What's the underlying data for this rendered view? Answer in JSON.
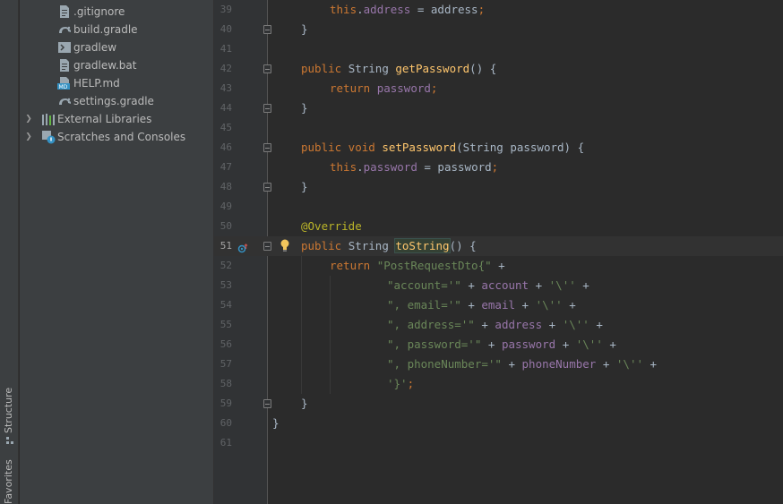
{
  "tool_tabs": {
    "structure": "Structure",
    "favorites": "Favorites"
  },
  "project_tree": [
    {
      "label": ".gitignore",
      "icon": "text-file-icon"
    },
    {
      "label": "build.gradle",
      "icon": "gradle-icon"
    },
    {
      "label": "gradlew",
      "icon": "shell-script-icon"
    },
    {
      "label": "gradlew.bat",
      "icon": "text-file-icon"
    },
    {
      "label": "HELP.md",
      "icon": "markdown-icon"
    },
    {
      "label": "settings.gradle",
      "icon": "gradle-icon"
    },
    {
      "label": "External Libraries",
      "icon": "libraries-icon",
      "expandable": true
    },
    {
      "label": "Scratches and Consoles",
      "icon": "scratches-icon",
      "expandable": true
    }
  ],
  "editor": {
    "current_line": "51",
    "lines": [
      {
        "n": "39",
        "tokens": [
          [
            "kw",
            "this"
          ],
          [
            "plain",
            "."
          ],
          [
            "fld",
            "address"
          ],
          [
            "plain",
            " = address"
          ],
          [
            "kw",
            ";"
          ]
        ],
        "indent": 2
      },
      {
        "n": "40",
        "tokens": [
          [
            "plain",
            "}"
          ]
        ],
        "indent": 1,
        "fold": true
      },
      {
        "n": "41",
        "tokens": [],
        "indent": 0
      },
      {
        "n": "42",
        "tokens": [
          [
            "kw",
            "public "
          ],
          [
            "plain",
            "String "
          ],
          [
            "fn",
            "getPassword"
          ],
          [
            "plain",
            "() {"
          ]
        ],
        "indent": 1,
        "fold": true
      },
      {
        "n": "43",
        "tokens": [
          [
            "kw",
            "return "
          ],
          [
            "fld",
            "password"
          ],
          [
            "kw",
            ";"
          ]
        ],
        "indent": 2
      },
      {
        "n": "44",
        "tokens": [
          [
            "plain",
            "}"
          ]
        ],
        "indent": 1,
        "fold": true
      },
      {
        "n": "45",
        "tokens": [],
        "indent": 0
      },
      {
        "n": "46",
        "tokens": [
          [
            "kw",
            "public void "
          ],
          [
            "fn",
            "setPassword"
          ],
          [
            "plain",
            "(String password) {"
          ]
        ],
        "indent": 1,
        "fold": true
      },
      {
        "n": "47",
        "tokens": [
          [
            "kw",
            "this"
          ],
          [
            "plain",
            "."
          ],
          [
            "fld",
            "password"
          ],
          [
            "plain",
            " = password"
          ],
          [
            "kw",
            ";"
          ]
        ],
        "indent": 2
      },
      {
        "n": "48",
        "tokens": [
          [
            "plain",
            "}"
          ]
        ],
        "indent": 1,
        "fold": true
      },
      {
        "n": "49",
        "tokens": [],
        "indent": 0
      },
      {
        "n": "50",
        "tokens": [
          [
            "ann",
            "@Override"
          ]
        ],
        "indent": 1
      },
      {
        "n": "51",
        "tokens": [
          [
            "kw",
            "public "
          ],
          [
            "plain",
            "String "
          ],
          [
            "caret",
            ""
          ],
          [
            "fnhl",
            "toString"
          ],
          [
            "plain",
            "() {"
          ]
        ],
        "indent": 1,
        "fold": true,
        "current": true,
        "override_marker": true,
        "bulb": true
      },
      {
        "n": "52",
        "tokens": [
          [
            "kw",
            "return "
          ],
          [
            "str",
            "\"PostRequestDto{\" "
          ],
          [
            "plain",
            "+"
          ]
        ],
        "indent": 2
      },
      {
        "n": "53",
        "tokens": [
          [
            "str",
            "\"account='\" "
          ],
          [
            "plain",
            "+ "
          ],
          [
            "fld",
            "account"
          ],
          [
            "plain",
            " + "
          ],
          [
            "str",
            "'\\''"
          ],
          [
            "plain",
            " +"
          ]
        ],
        "indent": 4
      },
      {
        "n": "54",
        "tokens": [
          [
            "str",
            "\", email='\" "
          ],
          [
            "plain",
            "+ "
          ],
          [
            "fld",
            "email"
          ],
          [
            "plain",
            " + "
          ],
          [
            "str",
            "'\\''"
          ],
          [
            "plain",
            " +"
          ]
        ],
        "indent": 4
      },
      {
        "n": "55",
        "tokens": [
          [
            "str",
            "\", address='\" "
          ],
          [
            "plain",
            "+ "
          ],
          [
            "fld",
            "address"
          ],
          [
            "plain",
            " + "
          ],
          [
            "str",
            "'\\''"
          ],
          [
            "plain",
            " +"
          ]
        ],
        "indent": 4
      },
      {
        "n": "56",
        "tokens": [
          [
            "str",
            "\", password='\" "
          ],
          [
            "plain",
            "+ "
          ],
          [
            "fld",
            "password"
          ],
          [
            "plain",
            " + "
          ],
          [
            "str",
            "'\\''"
          ],
          [
            "plain",
            " +"
          ]
        ],
        "indent": 4
      },
      {
        "n": "57",
        "tokens": [
          [
            "str",
            "\", phoneNumber='\" "
          ],
          [
            "plain",
            "+ "
          ],
          [
            "fld",
            "phoneNumber"
          ],
          [
            "plain",
            " + "
          ],
          [
            "str",
            "'\\''"
          ],
          [
            "plain",
            " +"
          ]
        ],
        "indent": 4
      },
      {
        "n": "58",
        "tokens": [
          [
            "str",
            "'}'"
          ],
          [
            "kw",
            ";"
          ]
        ],
        "indent": 4
      },
      {
        "n": "59",
        "tokens": [
          [
            "plain",
            "}"
          ]
        ],
        "indent": 1,
        "fold": true
      },
      {
        "n": "60",
        "tokens": [
          [
            "plain",
            "}"
          ]
        ],
        "indent": 0
      },
      {
        "n": "61",
        "tokens": [],
        "indent": 0
      }
    ]
  },
  "colors": {
    "background": "#2b2b2b",
    "gutter": "#313335",
    "keyword": "#cc7832",
    "field": "#9876aa",
    "string": "#6a8759",
    "method": "#ffc66d",
    "annotation": "#bbb529"
  }
}
